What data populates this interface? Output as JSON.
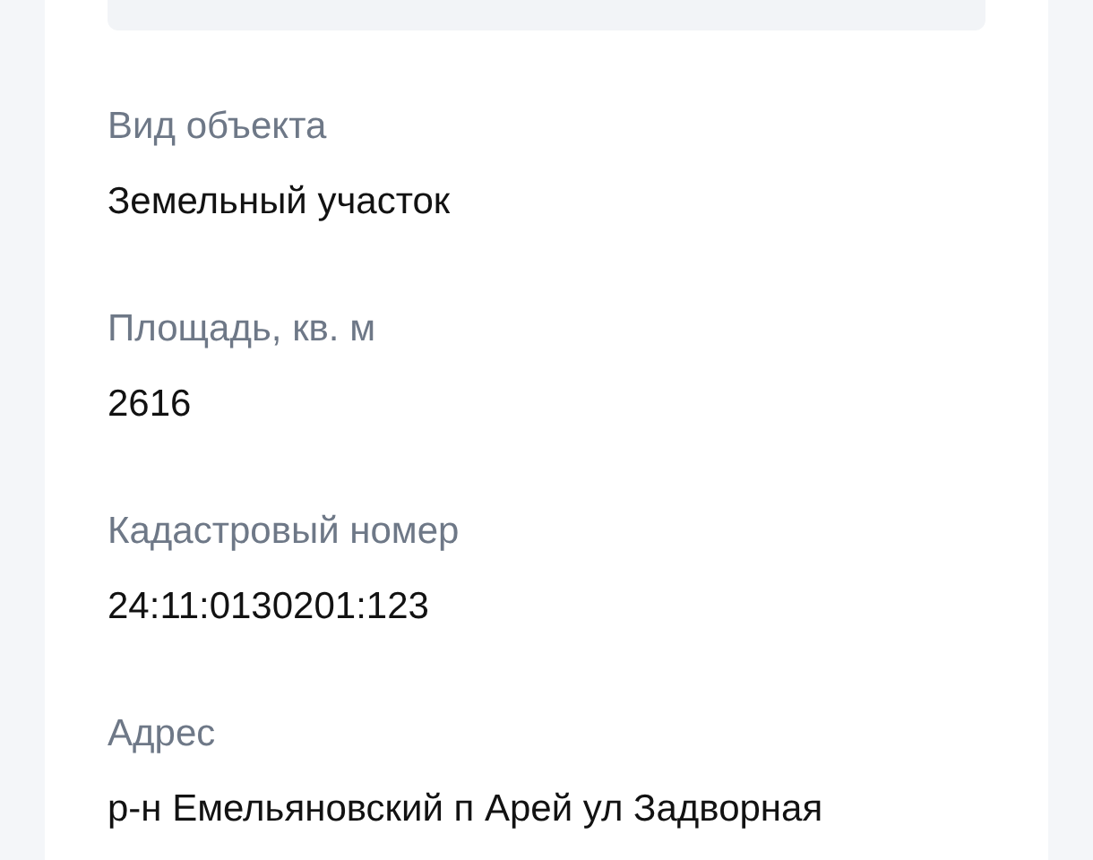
{
  "fields": [
    {
      "label": "Вид объекта",
      "value": "Земельный участок"
    },
    {
      "label": "Площадь, кв. м",
      "value": "2616"
    },
    {
      "label": "Кадастровый номер",
      "value": "24:11:0130201:123"
    },
    {
      "label": "Адрес",
      "value": "р-н Емельяновский п Арей ул Задворная"
    }
  ]
}
